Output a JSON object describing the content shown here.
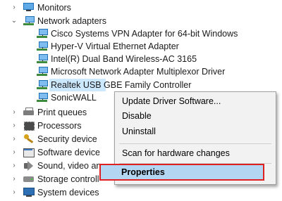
{
  "tree": {
    "monitors": "Monitors",
    "network_adapters": "Network adapters",
    "adapters": [
      "Cisco Systems VPN Adapter for 64-bit Windows",
      "Hyper-V Virtual Ethernet Adapter",
      "Intel(R) Dual Band Wireless-AC 3165",
      "Microsoft Network Adapter Multiplexor Driver",
      "Realtek USB GBE Family Controller",
      "SonicWALL"
    ],
    "print_queues": "Print queues",
    "processors": "Processors",
    "security_devices": "Security device",
    "software_devices": "Software device",
    "sound": "Sound, video an",
    "storage": "Storage controll",
    "system_devices": "System devices"
  },
  "context_menu": {
    "update_driver": "Update Driver Software...",
    "disable": "Disable",
    "uninstall": "Uninstall",
    "scan": "Scan for hardware changes",
    "properties": "Properties"
  },
  "colors": {
    "selection": "#cce8ff",
    "highlight_border": "#e02020",
    "properties_bg": "#b3d7f3"
  }
}
